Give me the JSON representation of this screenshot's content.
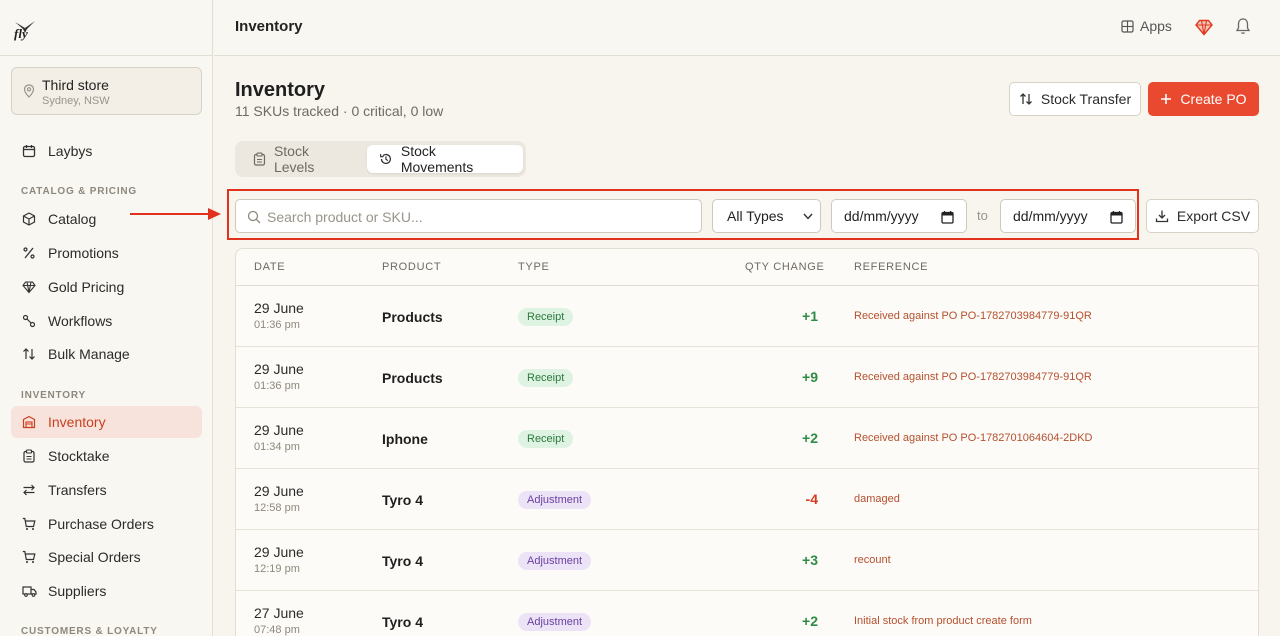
{
  "brand": {
    "logo_text": "fly"
  },
  "store": {
    "name": "Third store",
    "location": "Sydney, NSW"
  },
  "sidebar": {
    "top_item": {
      "label": "Laybys",
      "icon": "calendar-icon"
    },
    "sections": [
      {
        "title": "CATALOG & PRICING",
        "items": [
          {
            "label": "Catalog",
            "icon": "box-icon"
          },
          {
            "label": "Promotions",
            "icon": "percent-icon"
          },
          {
            "label": "Gold Pricing",
            "icon": "diamond-icon"
          },
          {
            "label": "Workflows",
            "icon": "workflow-icon"
          },
          {
            "label": "Bulk Manage",
            "icon": "sort-arrows-icon"
          }
        ]
      },
      {
        "title": "INVENTORY",
        "items": [
          {
            "label": "Inventory",
            "icon": "warehouse-icon",
            "active": true
          },
          {
            "label": "Stocktake",
            "icon": "clipboard-icon"
          },
          {
            "label": "Transfers",
            "icon": "transfer-arrows-icon"
          },
          {
            "label": "Purchase Orders",
            "icon": "cart-icon"
          },
          {
            "label": "Special Orders",
            "icon": "cart-icon"
          },
          {
            "label": "Suppliers",
            "icon": "truck-icon"
          }
        ]
      },
      {
        "title": "CUSTOMERS & LOYALTY",
        "items": []
      }
    ]
  },
  "topbar": {
    "title": "Inventory",
    "apps_label": "Apps"
  },
  "page": {
    "title": "Inventory",
    "subtitle": "11 SKUs tracked · 0 critical, 0 low",
    "stock_transfer_label": "Stock Transfer",
    "create_po_label": "Create PO"
  },
  "tabs": [
    {
      "label": "Stock Levels",
      "active": false
    },
    {
      "label": "Stock Movements",
      "active": true
    }
  ],
  "filters": {
    "search_placeholder": "Search product or SKU...",
    "type_value": "All Types",
    "date_from": "dd/mm/yyyy",
    "to_label": "to",
    "date_to": "dd/mm/yyyy",
    "export_label": "Export CSV"
  },
  "table": {
    "columns": [
      "DATE",
      "PRODUCT",
      "TYPE",
      "QTY CHANGE",
      "REFERENCE"
    ],
    "rows": [
      {
        "date": "29 June",
        "time": "01:36 pm",
        "product": "Products",
        "type": "Receipt",
        "qty": "+1",
        "reference": "Received against PO PO-1782703984779-91QR"
      },
      {
        "date": "29 June",
        "time": "01:36 pm",
        "product": "Products",
        "type": "Receipt",
        "qty": "+9",
        "reference": "Received against PO PO-1782703984779-91QR"
      },
      {
        "date": "29 June",
        "time": "01:34 pm",
        "product": "Iphone",
        "type": "Receipt",
        "qty": "+2",
        "reference": "Received against PO PO-1782701064604-2DKD"
      },
      {
        "date": "29 June",
        "time": "12:58 pm",
        "product": "Tyro 4",
        "type": "Adjustment",
        "qty": "-4",
        "reference": "damaged"
      },
      {
        "date": "29 June",
        "time": "12:19 pm",
        "product": "Tyro 4",
        "type": "Adjustment",
        "qty": "+3",
        "reference": "recount"
      },
      {
        "date": "27 June",
        "time": "07:48 pm",
        "product": "Tyro 4",
        "type": "Adjustment",
        "qty": "+2",
        "reference": "Initial stock from product create form"
      }
    ]
  },
  "colors": {
    "accent": "#e94a2f",
    "active_bg": "#f8e3dc",
    "highlight": "#e0321c",
    "positive": "#2e8b45",
    "negative": "#d63b24"
  }
}
